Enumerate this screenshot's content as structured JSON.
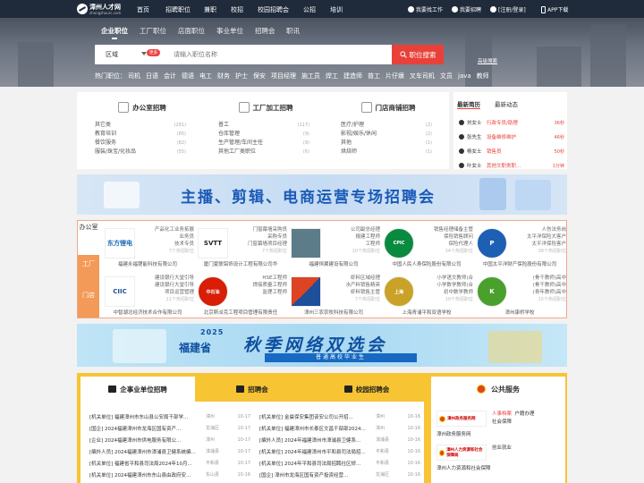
{
  "topbar": {
    "logo_name": "漳州人才网",
    "logo_domain": "zhangzhourc.com",
    "nav": [
      "首页",
      "招聘职位",
      "兼职",
      "校招",
      "校园招聘会",
      "公招",
      "培训"
    ],
    "find_job": "我要找工作",
    "recruit": "我要招聘",
    "login": "[注册/登录]",
    "app": "APP下载"
  },
  "search": {
    "tabs": [
      "企业职位",
      "工厂职位",
      "店面职位",
      "事业单位",
      "招聘会",
      "职讯"
    ],
    "active_tab": 0,
    "region": "区域",
    "more_badge": "更多",
    "placeholder": "请输入职位名称",
    "button": "职位搜索",
    "advanced": "高级搜索",
    "hot_label": "热门职位：",
    "hot": [
      "司机",
      "日语",
      "会计",
      "德语",
      "电工",
      "财务",
      "护士",
      "保安",
      "项目经理",
      "施工员",
      "焊工",
      "建造师",
      "普工",
      "片仔癀",
      "叉车司机",
      "文员",
      "java",
      "教师"
    ]
  },
  "categories": [
    {
      "title": "办公室招聘",
      "icon": "briefcase-icon",
      "items": [
        {
          "n": "其它类",
          "c": "(291)"
        },
        {
          "n": "教育培训",
          "c": "(85)"
        },
        {
          "n": "餐饮服务",
          "c": "(82)"
        },
        {
          "n": "服装/珠宝/化妆品",
          "c": "(55)"
        }
      ]
    },
    {
      "title": "工厂加工招聘",
      "icon": "factory-icon",
      "items": [
        {
          "n": "普工",
          "c": "(117)"
        },
        {
          "n": "仓库管理",
          "c": "(9)"
        },
        {
          "n": "生产管理/车间主任",
          "c": "(9)"
        },
        {
          "n": "其他工厂类职位",
          "c": "(6)"
        }
      ]
    },
    {
      "title": "门店商铺招聘",
      "icon": "storefront-icon",
      "items": [
        {
          "n": "医疗/护理",
          "c": "(2)"
        },
        {
          "n": "影视/娱乐/休闲",
          "c": "(2)"
        },
        {
          "n": "其他",
          "c": "(1)"
        },
        {
          "n": "烘焙师",
          "c": "(1)"
        }
      ]
    }
  ],
  "resumes": {
    "tabs": [
      "最新简历",
      "最新动态"
    ],
    "rows": [
      {
        "name": "刘女士",
        "job": "行政专员/助理",
        "time": "36秒"
      },
      {
        "name": "张先生",
        "job": "设备维修维护",
        "time": "46秒"
      },
      {
        "name": "杨女士",
        "job": "销售员",
        "time": "50秒"
      },
      {
        "name": "叶女士",
        "job": "其他文职类职...",
        "time": "1分钟"
      }
    ]
  },
  "banner1": {
    "text": "主播、剪辑、电商运营专场招聘会"
  },
  "company_tabs": [
    "办公室",
    "工厂",
    "门店"
  ],
  "companies": [
    {
      "logo": "东方锂电",
      "jobs": [
        "产品化工业务拓展",
        "业务员",
        "技术专员"
      ],
      "more": "7个热招职位",
      "name": "福建永福锂能科技有限公司"
    },
    {
      "logo": "SVTT",
      "jobs": [
        "门窗幕墙采购员",
        "采购专员",
        "门窗幕墙项目经理"
      ],
      "more": "7个热招职位",
      "name": "厦门夏联铝饰设计工程有限公司华"
    },
    {
      "logo": "",
      "jobs": [
        "公司副总经理",
        "报建工程师",
        "工程师"
      ],
      "more": "10个热招职位",
      "name": "福建恒翼建设有限公司"
    },
    {
      "logo": "CPIC",
      "jobs": [
        "销售经理储备主管",
        "保险销售顾问",
        "保险代理人"
      ],
      "more": "34个热招职位",
      "name": "中国人民人寿保险股份有限公司"
    },
    {
      "logo": "P",
      "jobs": [
        "人伤法务岗",
        "太平洋保险大客户",
        "太平洋保险客户"
      ],
      "more": "38个热招职位",
      "name": "中国太平洋财产保险股份有限公司"
    },
    {
      "logo": "CIIC",
      "jobs": [
        "建设银行大堂引导",
        "建设银行大堂引导",
        "项目运营管理"
      ],
      "more": "11个热招职位",
      "name": "中智湖北经济技术合作有限公司"
    },
    {
      "logo": "中石油",
      "jobs": [
        "HSE工程师",
        "焊接质量工程师",
        "监理工程师"
      ],
      "more": "",
      "name": "北京斯派克工程项目管理有限责任"
    },
    {
      "logo": "",
      "jobs": [
        "虾料区域经理",
        "水产料销售精英",
        "虾料销售主管"
      ],
      "more": "7个热招职位",
      "name": "漳州三农农牧科技有限公司"
    },
    {
      "logo": "上海",
      "jobs": [
        "小学语文教师(合",
        "小学数学教师(合",
        "初中数学教师"
      ],
      "more": "10个热招职位",
      "name": "上海青浦平和双语学校"
    },
    {
      "logo": "K",
      "jobs": [
        "(骨干教师)高中",
        "(骨干教师)高中",
        "(青年教师)高中"
      ],
      "more": "15个热招职位",
      "name": "漳州康桥学校"
    }
  ],
  "banner2": {
    "year": "2025",
    "province": "福建省",
    "title": "秋季网络双选会",
    "subtitle": "普通高校毕业生"
  },
  "news": {
    "tabs": [
      "企事业单位招聘",
      "招聘会",
      "校园招聘会"
    ],
    "left": [
      {
        "t": "[机关单位] 福建漳州市东山县公安局干部学...",
        "a": "漳州",
        "d": "10-17"
      },
      {
        "t": "[国企] 2024福建漳州市龙海区国有资产...",
        "a": "龙海区",
        "d": "10-17"
      },
      {
        "t": "[企业] 2024福建漳州市供电服务有限公...",
        "a": "漳州",
        "d": "10-17"
      },
      {
        "t": "[编外人员] 2024福建漳州市漳浦县卫健系统编...",
        "a": "漳浦县",
        "d": "10-17"
      },
      {
        "t": "[机关单位] 福建省平和县司法局2024年10月...",
        "a": "平和县",
        "d": "10-17"
      },
      {
        "t": "[机关单位] 2024福建漳州市东山县由政府安...",
        "a": "东山县",
        "d": "10-16"
      }
    ],
    "right": [
      {
        "t": "[机关单位] 金晨保安集团该安公司公开招...",
        "a": "漳州",
        "d": "10-16"
      },
      {
        "t": "[机关单位] 福建漳州市长泰区文昌干部部2024...",
        "a": "漳州",
        "d": "10-16"
      },
      {
        "t": "[编外人员] 2024年福建漳州市漳浦县卫健系...",
        "a": "漳浦县",
        "d": "10-16"
      },
      {
        "t": "[机关单位] 2024年福建漳州市平和县司法局招...",
        "a": "平和县",
        "d": "10-16"
      },
      {
        "t": "[机关单位] 2024年平和县司法局招聘社区矫...",
        "a": "平和县",
        "d": "10-16"
      },
      {
        "t": "[国企] 漳州市龙海区国有资产投资经营...",
        "a": "龙海区",
        "d": "10-16"
      }
    ]
  },
  "services": {
    "title": "公共服务",
    "items": [
      {
        "logo": "漳州政务服务网",
        "links": [
          "人事档案",
          "户籍办理",
          "社会保障"
        ],
        "name": "漳州政务服务网"
      },
      {
        "logo": "漳州人力资源和社会保障局",
        "links": [
          "创业就业"
        ],
        "name": "漳州人力资源和社会保障"
      }
    ]
  },
  "colors": {
    "accent": "#e9413a",
    "topbar": "#1f2a3a",
    "orange": "#f39a58",
    "yellow": "#f7c433",
    "blue": "#1a5ab8"
  }
}
